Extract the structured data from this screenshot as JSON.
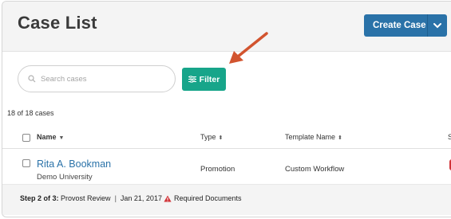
{
  "page": {
    "title": "Case List"
  },
  "toolbar": {
    "create_label": "Create Case",
    "search_placeholder": "Search cases",
    "filter_label": "Filter"
  },
  "results": {
    "count_text": "18 of 18 cases"
  },
  "table": {
    "columns": [
      {
        "label": "Name",
        "sort_icon": "caret-down-icon"
      },
      {
        "label": "Type",
        "sort_icon": "sort-icon"
      },
      {
        "label": "Template Name",
        "sort_icon": "sort-icon"
      },
      {
        "label": "S"
      }
    ],
    "rows": [
      {
        "name": "Rita A. Bookman",
        "institution": "Demo University",
        "type": "Promotion",
        "template": "Custom Workflow",
        "status": {
          "step": "Step 2 of 3:",
          "step_name": "Provost Review",
          "separator": "|",
          "date": "Jan 21, 2017",
          "alert": "Required Documents"
        }
      }
    ]
  },
  "colors": {
    "primary": "#2a72a8",
    "filter": "#17a58a",
    "alert": "#d13438",
    "annotation_arrow": "#d2542f"
  }
}
